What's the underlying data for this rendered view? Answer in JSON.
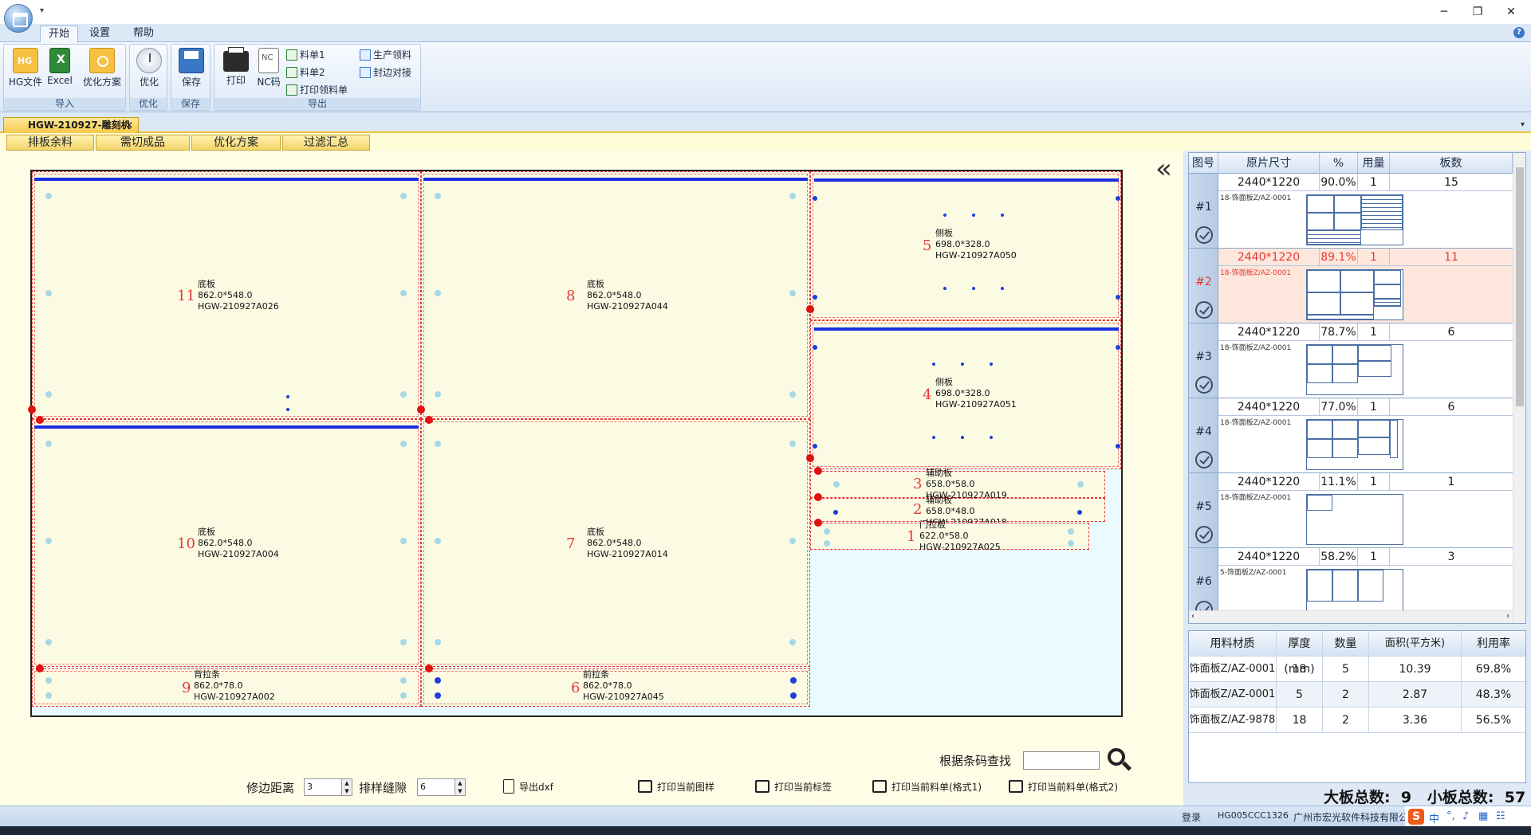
{
  "titlebar": {
    "min": "─",
    "restore": "❐",
    "close": "✕"
  },
  "ribbon_tabs": [
    "开始",
    "设置",
    "帮助"
  ],
  "ribbon": {
    "import": {
      "label": "导入",
      "hg": "HG文件",
      "excel": "Excel",
      "plan": "优化方案"
    },
    "optimize": {
      "label": "优化",
      "btn": "优化"
    },
    "save": {
      "label": "保存",
      "btn": "保存"
    },
    "export": {
      "label": "导出",
      "print": "打印",
      "nc": "NC码",
      "list1": "料单1",
      "list2": "料单2",
      "print_pick": "打印领料单",
      "prod_pick": "生产领料",
      "edge": "封边对接"
    }
  },
  "doc_tab": "HGW-210927-雕刻机",
  "sub_tabs": [
    "排板余料",
    "需切成品",
    "优化方案",
    "过滤汇总"
  ],
  "pieces": [
    {
      "no": "11",
      "name": "底板",
      "size": "862.0*548.0",
      "code": "HGW-210927A026"
    },
    {
      "no": "8",
      "name": "底板",
      "size": "862.0*548.0",
      "code": "HGW-210927A044"
    },
    {
      "no": "5",
      "name": "侧板",
      "size": "698.0*328.0",
      "code": "HGW-210927A050"
    },
    {
      "no": "4",
      "name": "侧板",
      "size": "698.0*328.0",
      "code": "HGW-210927A051"
    },
    {
      "no": "10",
      "name": "底板",
      "size": "862.0*548.0",
      "code": "HGW-210927A004"
    },
    {
      "no": "7",
      "name": "底板",
      "size": "862.0*548.0",
      "code": "HGW-210927A014"
    },
    {
      "no": "3",
      "name": "辅助板",
      "size": "658.0*58.0",
      "code": "HGW-210927A019"
    },
    {
      "no": "2",
      "name": "辅助板",
      "size": "658.0*48.0",
      "code": "HGW-210927A018"
    },
    {
      "no": "1",
      "name": "门拉板",
      "size": "622.0*58.0",
      "code": "HGW-210927A025"
    },
    {
      "no": "9",
      "name": "背拉条",
      "size": "862.0*78.0",
      "code": "HGW-210927A002"
    },
    {
      "no": "6",
      "name": "前拉条",
      "size": "862.0*78.0",
      "code": "HGW-210927A045"
    }
  ],
  "controls": {
    "trim_label": "修边距离",
    "trim_value": "3",
    "gap_label": "排样缝隙",
    "gap_value": "6",
    "export_dxf": "导出dxf",
    "print_pattern": "打印当前图样",
    "print_label": "打印当前标签",
    "print_list1": "打印当前料单(格式1)",
    "print_list2": "打印当前料单(格式2)",
    "search_label": "根据条码查找"
  },
  "sheet_table": {
    "headers": [
      "图号",
      "原片尺寸",
      "%",
      "用量",
      "板数"
    ],
    "rows": [
      {
        "id": "#1",
        "size": "2440*1220",
        "pct": "90.0%",
        "qty": "1",
        "count": "15",
        "material": "18-饰面板Z/AZ-0001",
        "selected": false
      },
      {
        "id": "#2",
        "size": "2440*1220",
        "pct": "89.1%",
        "qty": "1",
        "count": "11",
        "material": "18-饰面板Z/AZ-0001",
        "selected": true
      },
      {
        "id": "#3",
        "size": "2440*1220",
        "pct": "78.7%",
        "qty": "1",
        "count": "6",
        "material": "18-饰面板Z/AZ-0001",
        "selected": false
      },
      {
        "id": "#4",
        "size": "2440*1220",
        "pct": "77.0%",
        "qty": "1",
        "count": "6",
        "material": "18-饰面板Z/AZ-0001",
        "selected": false
      },
      {
        "id": "#5",
        "size": "2440*1220",
        "pct": "11.1%",
        "qty": "1",
        "count": "1",
        "material": "18-饰面板Z/AZ-0001",
        "selected": false
      },
      {
        "id": "#6",
        "size": "2440*1220",
        "pct": "58.2%",
        "qty": "1",
        "count": "3",
        "material": "5-饰面板Z/AZ-0001",
        "selected": false
      }
    ]
  },
  "material_table": {
    "headers": [
      "用料材质",
      "厚度(mm)",
      "数量",
      "面积(平方米)",
      "利用率"
    ],
    "rows": [
      [
        "饰面板Z/AZ-0001",
        "18",
        "5",
        "10.39",
        "69.8%"
      ],
      [
        "饰面板Z/AZ-0001",
        "5",
        "2",
        "2.87",
        "48.3%"
      ],
      [
        "饰面板Z/AZ-9878",
        "18",
        "2",
        "3.36",
        "56.5%"
      ]
    ]
  },
  "totals": "大板总数:  9   小板总数:  57",
  "statusbar": {
    "login": "登录",
    "code": "HG005CCC1326",
    "company": "广州市宏光软件科技有限公司"
  },
  "ime": {
    "logo": "S",
    "lang": "中"
  }
}
